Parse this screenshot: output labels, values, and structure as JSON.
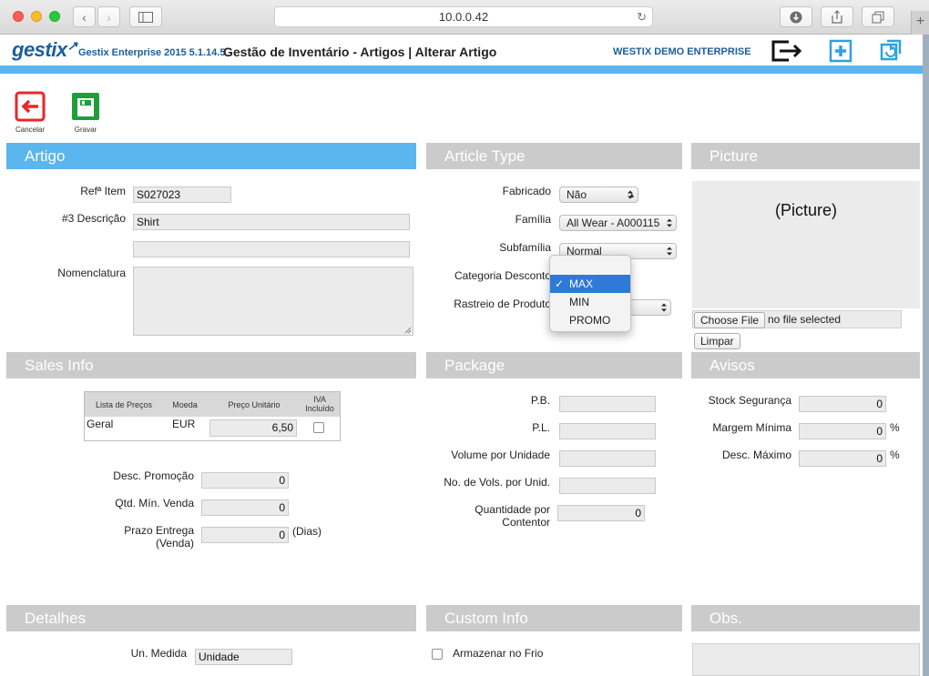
{
  "browser": {
    "url": "10.0.0.42"
  },
  "header": {
    "logo": "gestix",
    "version": "Gestix Enterprise 2015 5.1.14.5",
    "title": "Gestão de Inventário - Artigos | Alterar Artigo",
    "enterprise": "WESTIX DEMO ENTERPRISE",
    "icons": [
      "logout-icon",
      "add-icon",
      "refresh-icon"
    ]
  },
  "toolbar": {
    "cancel_label": "Cancelar",
    "save_label": "Gravar"
  },
  "artigo": {
    "title": "Artigo",
    "ref_label": "Refª Item",
    "ref_value": "S027023",
    "desc_label": "#3 Descrição",
    "desc_value": "Shirt",
    "desc2_value": "",
    "nomenclatura_label": "Nomenclatura",
    "nomenclatura_value": ""
  },
  "article_type": {
    "title": "Article Type",
    "fabricado_label": "Fabricado",
    "fabricado_value": "Não",
    "familia_label": "Família",
    "familia_value": "All Wear - A000115",
    "subfamilia_label": "Subfamília",
    "subfamilia_value": "Normal",
    "categoria_label": "Categoria Desconto",
    "rastreio_label": "Rastreio de Produto",
    "dropdown_options": [
      "MAX",
      "MIN",
      "PROMO"
    ],
    "dropdown_selected": "MAX"
  },
  "picture": {
    "title": "Picture",
    "placeholder": "(Picture)",
    "choose_file_label": "Choose File",
    "file_status": "no file selected",
    "clear_label": "Limpar"
  },
  "sales_info": {
    "title": "Sales Info",
    "table_headers": [
      "Lista de Preços",
      "Moeda",
      "Preço Unitário",
      "IVA Incluído"
    ],
    "table_rows": [
      {
        "lista": "Geral",
        "moeda": "EUR",
        "preco": "6,50",
        "iva": false
      }
    ],
    "desc_promocao_label": "Desc. Promoção",
    "desc_promocao_value": "0",
    "qtd_min_label": "Qtd. Mín. Venda",
    "qtd_min_value": "0",
    "prazo_label_1": "Prazo Entrega",
    "prazo_label_2": "(Venda)",
    "prazo_value": "0",
    "prazo_unit": "(Dias)"
  },
  "package": {
    "title": "Package",
    "pb_label": "P.B.",
    "pl_label": "P.L.",
    "volume_label": "Volume por Unidade",
    "vols_label": "No. de Vols. por Unid.",
    "qtd_contentor_label_1": "Quantidade por",
    "qtd_contentor_label_2": "Contentor",
    "qtd_contentor_value": "0"
  },
  "avisos": {
    "title": "Avisos",
    "stock_label": "Stock Segurança",
    "stock_value": "0",
    "margem_label": "Margem Mínima",
    "margem_value": "0",
    "margem_unit": "%",
    "desc_max_label": "Desc. Máximo",
    "desc_max_value": "0",
    "desc_max_unit": "%"
  },
  "detalhes": {
    "title": "Detalhes",
    "un_medida_label": "Un. Medida",
    "un_medida_value": "Unidade"
  },
  "custom_info": {
    "title": "Custom Info",
    "armazenar_label": "Armazenar no Frio"
  },
  "obs": {
    "title": "Obs."
  },
  "colors": {
    "accent_blue": "#5bb5ee",
    "section_grey": "#cbcbcb",
    "brand_blue": "#1b5d9e",
    "cancel_red": "#e8262a",
    "save_green": "#1f9d3a",
    "icon_blue": "#2aa3e0"
  }
}
